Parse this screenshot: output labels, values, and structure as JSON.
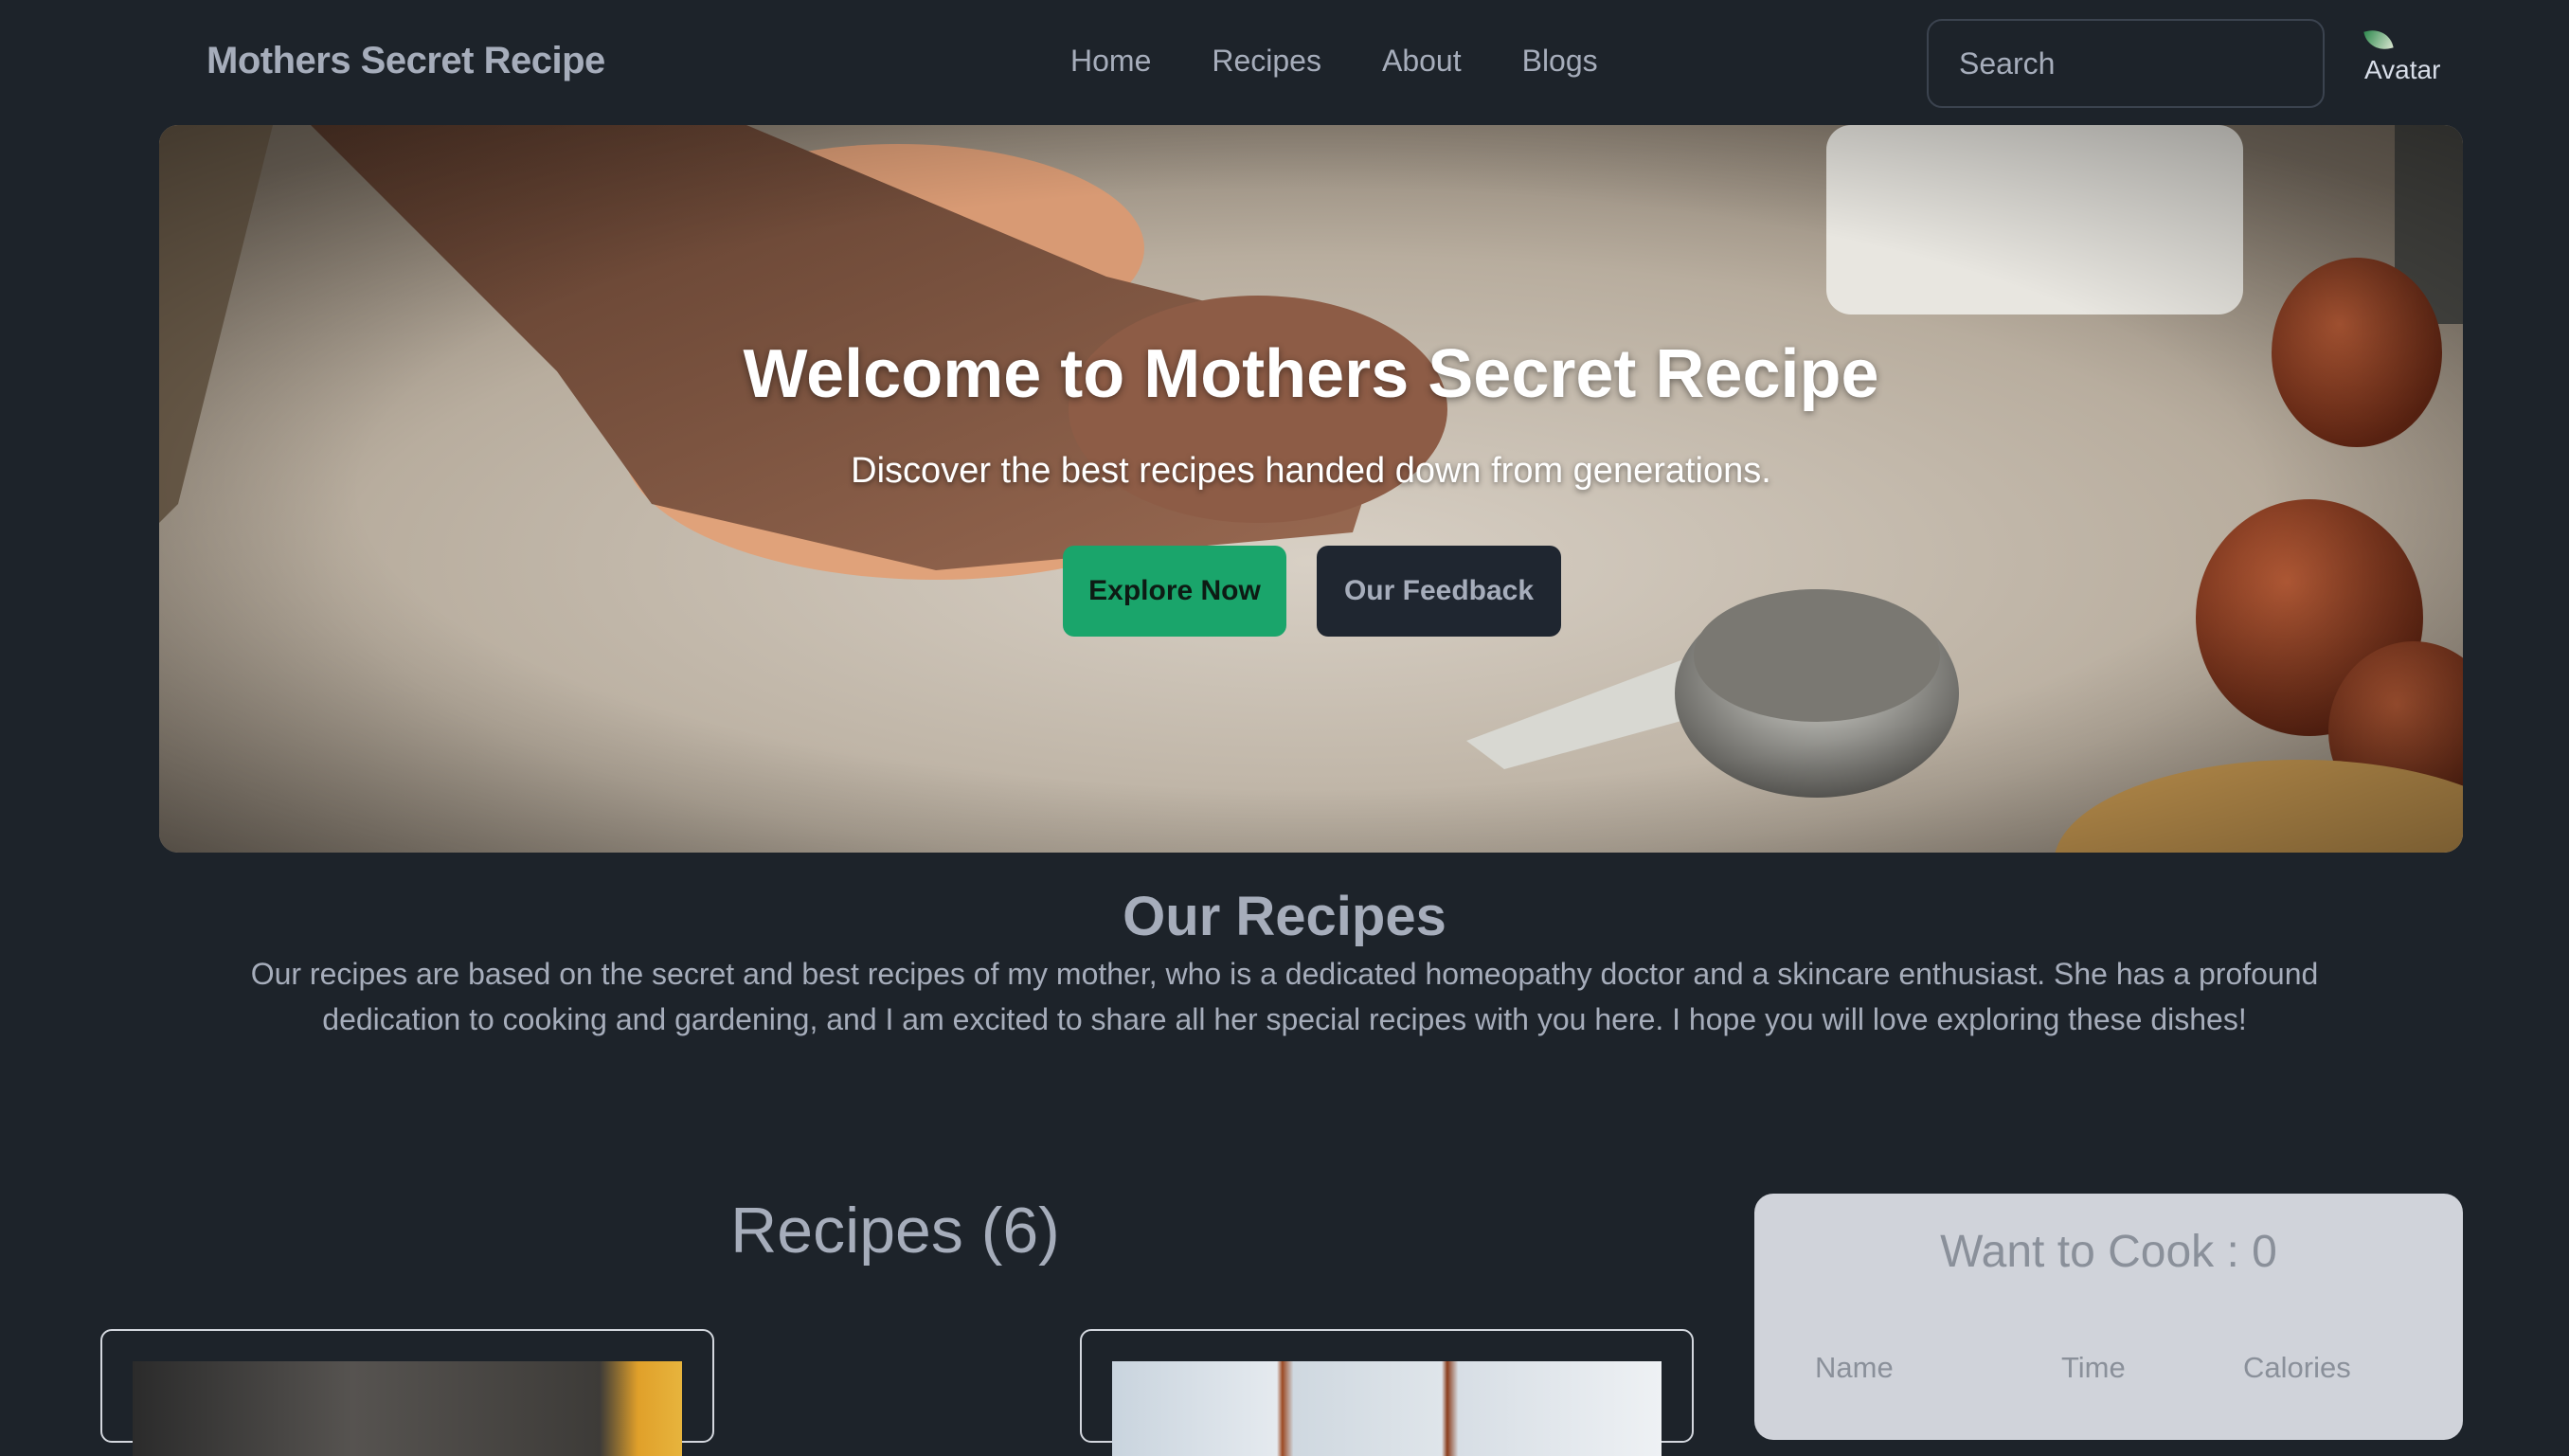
{
  "navbar": {
    "brand": "Mothers Secret Recipe",
    "links": [
      "Home",
      "Recipes",
      "About",
      "Blogs"
    ],
    "search_placeholder": "Search",
    "avatar_alt": "Avatar"
  },
  "hero": {
    "title": "Welcome to Mothers Secret Recipe",
    "subtitle": "Discover the best recipes handed down from generations.",
    "explore_label": "Explore Now",
    "feedback_label": "Our Feedback"
  },
  "about": {
    "title": "Our Recipes",
    "description": "Our recipes are based on the secret and best recipes of my mother, who is a dedicated homeopathy doctor and a skincare enthusiast. She has a profound dedication to cooking and gardening, and I am excited to share all her special recipes with you here. I hope you will love exploring these dishes!"
  },
  "recipes": {
    "heading": "Recipes (6)"
  },
  "want_to_cook": {
    "title": "Want to Cook : 0",
    "columns": [
      "Name",
      "Time",
      "Calories"
    ]
  },
  "colors": {
    "background": "#1d232a",
    "text_muted": "#a6adbb",
    "accent": "#1aa56b",
    "panel": "#d0d3da"
  }
}
